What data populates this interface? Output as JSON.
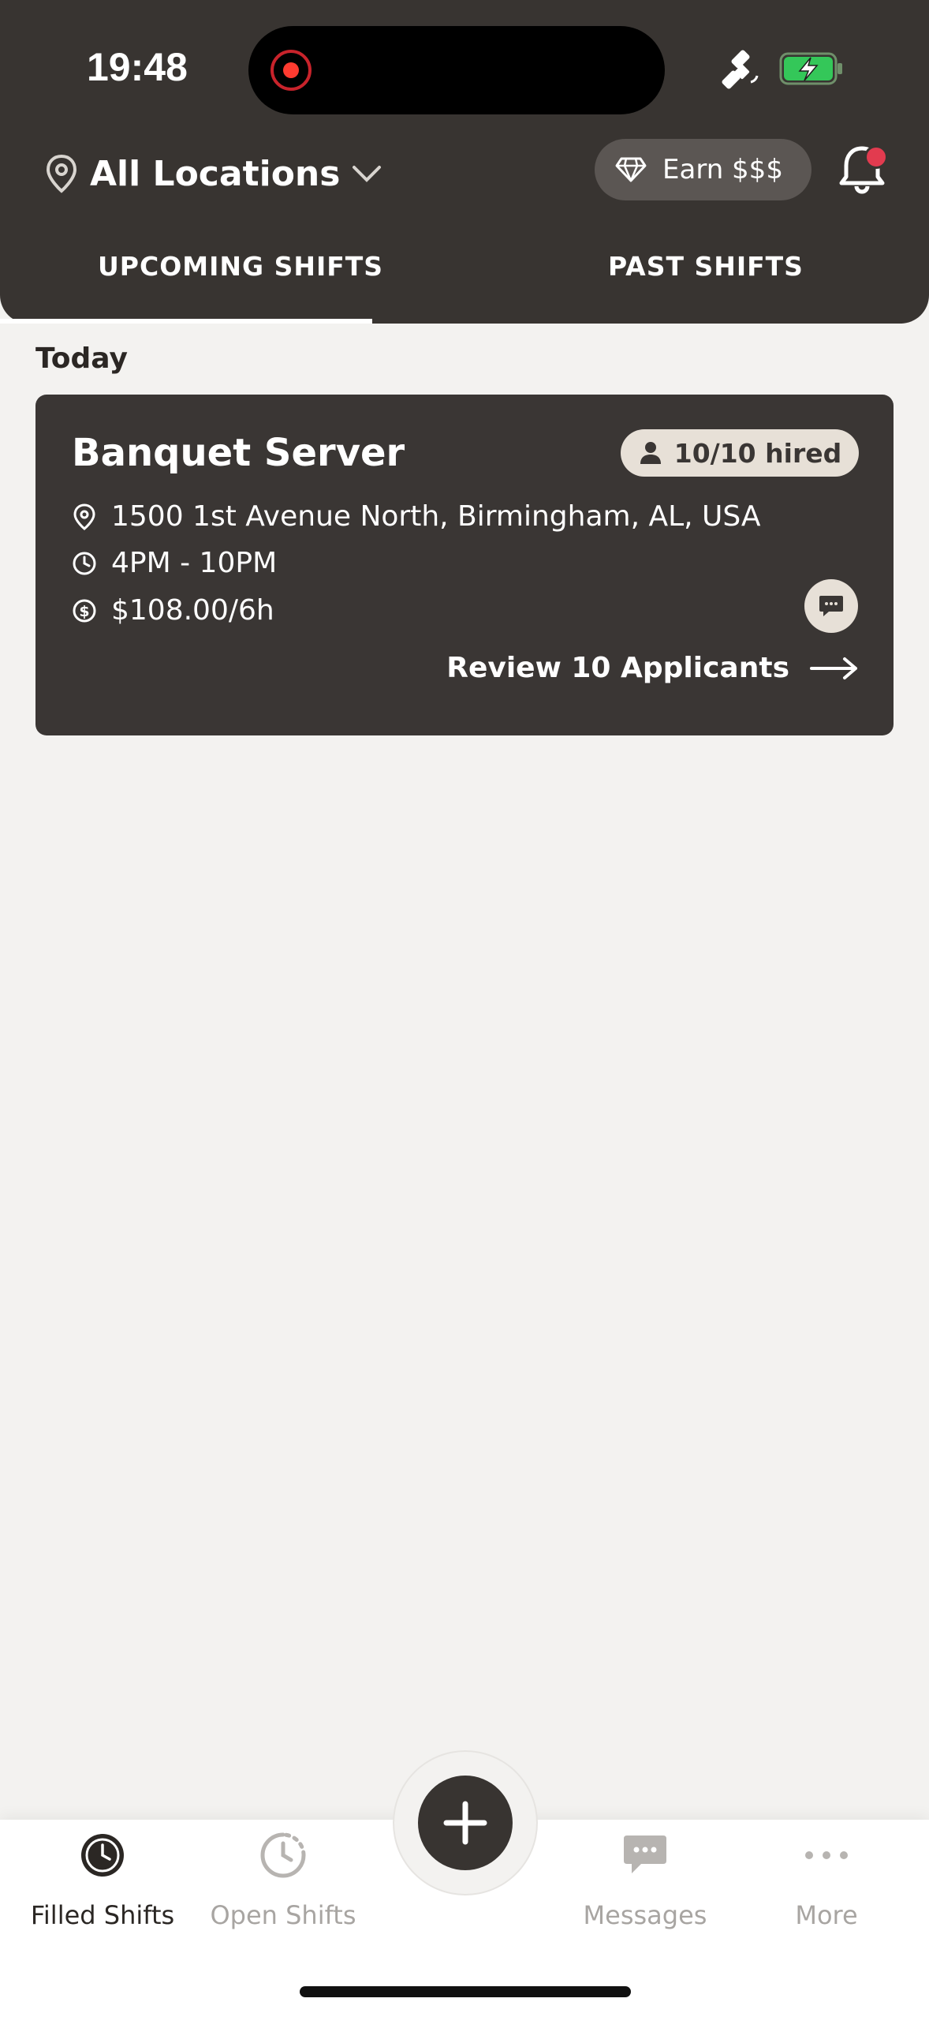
{
  "status_bar": {
    "time": "19:48"
  },
  "header": {
    "location_label": "All Locations",
    "earn_label": "Earn $$$",
    "tabs": [
      {
        "label": "UPCOMING SHIFTS",
        "active": true
      },
      {
        "label": "PAST SHIFTS",
        "active": false
      }
    ]
  },
  "section": {
    "label": "Today"
  },
  "shift_card": {
    "title": "Banquet Server",
    "hired": "10/10 hired",
    "address": "1500 1st Avenue North, Birmingham, AL, USA",
    "time": "4PM - 10PM",
    "pay": "$108.00/6h",
    "review_label": "Review 10 Applicants"
  },
  "bottom_nav": [
    {
      "label": "Filled Shifts",
      "icon": "clock-filled-icon",
      "active": true
    },
    {
      "label": "Open Shifts",
      "icon": "clock-dashed-icon",
      "active": false
    },
    {
      "label": "Messages",
      "icon": "chat-icon",
      "active": false
    },
    {
      "label": "More",
      "icon": "more-dots-icon",
      "active": false
    }
  ],
  "colors": {
    "header_bg": "#383431",
    "card_bg": "#3a3634",
    "badge_bg": "#e7e0d7",
    "page_bg": "#f3f2f0",
    "notification_dot": "#e23b4f",
    "battery_green": "#34c759"
  }
}
